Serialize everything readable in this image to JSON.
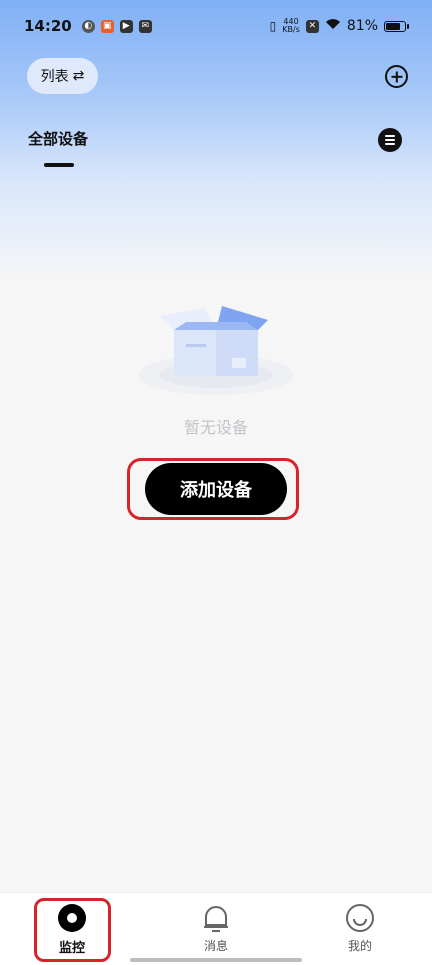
{
  "status_bar": {
    "time": "14:20",
    "net_speed_value": "440",
    "net_speed_unit": "KB/s",
    "battery": "81%",
    "battery_level": 0.81
  },
  "header": {
    "view_toggle_label": "列表",
    "view_toggle_icon": "⇄",
    "group_tab": "全部设备"
  },
  "empty_state": {
    "text": "暂无设备",
    "add_button_label": "添加设备"
  },
  "bottom_nav": {
    "items": [
      {
        "label": "监控",
        "icon": "camera-icon",
        "active": true
      },
      {
        "label": "消息",
        "icon": "bell-icon",
        "active": false
      },
      {
        "label": "我的",
        "icon": "smile-icon",
        "active": false
      }
    ]
  },
  "colors": {
    "accent_highlight": "#d8232a",
    "header_gradient_top": "#7fb0f6",
    "primary_button": "#000000"
  }
}
